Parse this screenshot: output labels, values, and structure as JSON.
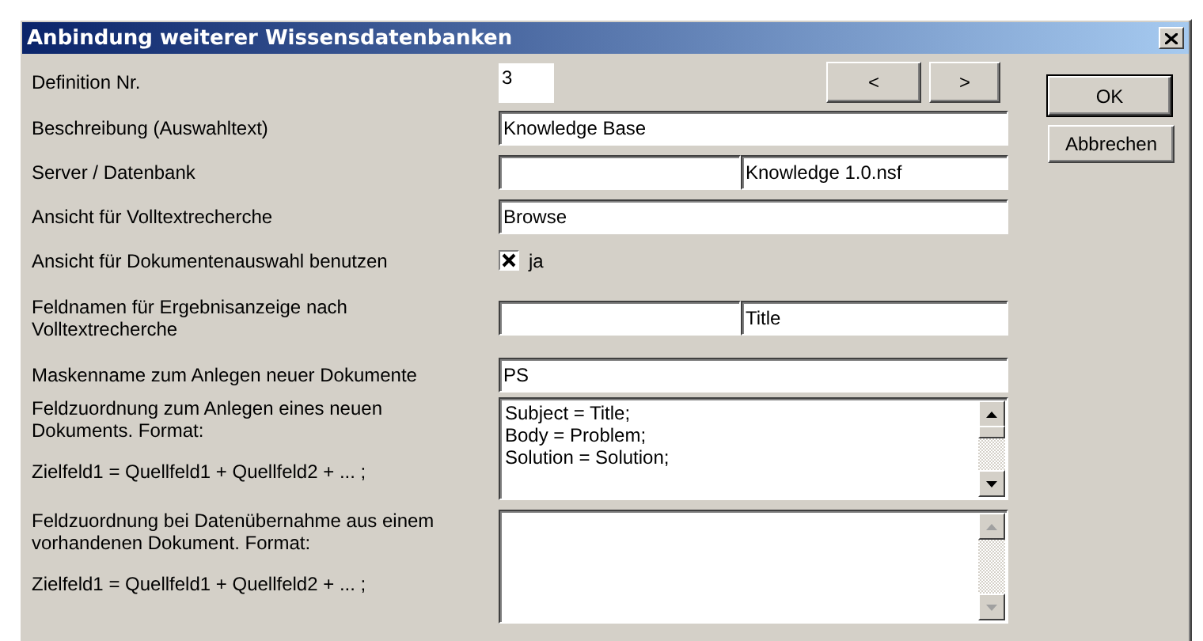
{
  "window": {
    "title": "Anbindung weiterer Wissensdatenbanken"
  },
  "nav_buttons": [
    "<",
    ">"
  ],
  "rows": [
    {
      "kind": "short",
      "label": [
        "Definition Nr."
      ],
      "values": [
        "3"
      ]
    },
    {
      "kind": "text",
      "label": [
        "Beschreibung (Auswahltext)"
      ],
      "values": [
        "Knowledge Base"
      ]
    },
    {
      "kind": "pair",
      "label": [
        "Server / Datenbank"
      ],
      "value": "Knowledge 1.0.nsf"
    },
    {
      "kind": "text",
      "label": [
        "Ansicht für Volltextrecherche"
      ],
      "values": [
        "Browse"
      ]
    },
    {
      "kind": "checkbox",
      "label": [
        "Ansicht für Dokumentenauswahl benutzen"
      ],
      "checked": true,
      "option": "ja"
    },
    {
      "kind": "pair",
      "label": [
        "Feldnamen für Ergebnisanzeige nach Volltextrecherche"
      ],
      "value": "Title"
    },
    {
      "kind": "text",
      "label": [
        "Maskenname zum Anlegen neuer Dokumente"
      ],
      "values": [
        "PS"
      ]
    },
    {
      "kind": "memo",
      "label": [
        "Feldzuordnung zum Anlegen eines neuen Dokuments. Format:",
        "Zielfeld1 = Quellfeld1 + Quellfeld2 + ... ;"
      ],
      "lines": [
        "Subject = Title;",
        "Body = Problem;",
        "Solution = Solution;"
      ],
      "scrollbar": {
        "disabled": false
      }
    },
    {
      "kind": "memo",
      "label": [
        "Feldzuordnung bei Datenübernahme aus einem vorhandenen Dokument. Format:",
        "Zielfeld1 = Quellfeld1 + Quellfeld2 + ... ;"
      ],
      "scrollbar": {
        "disabled": true
      }
    }
  ],
  "buttons": [
    {
      "label": "OK",
      "default": true
    },
    {
      "label": "Abbrechen",
      "default": false
    }
  ]
}
